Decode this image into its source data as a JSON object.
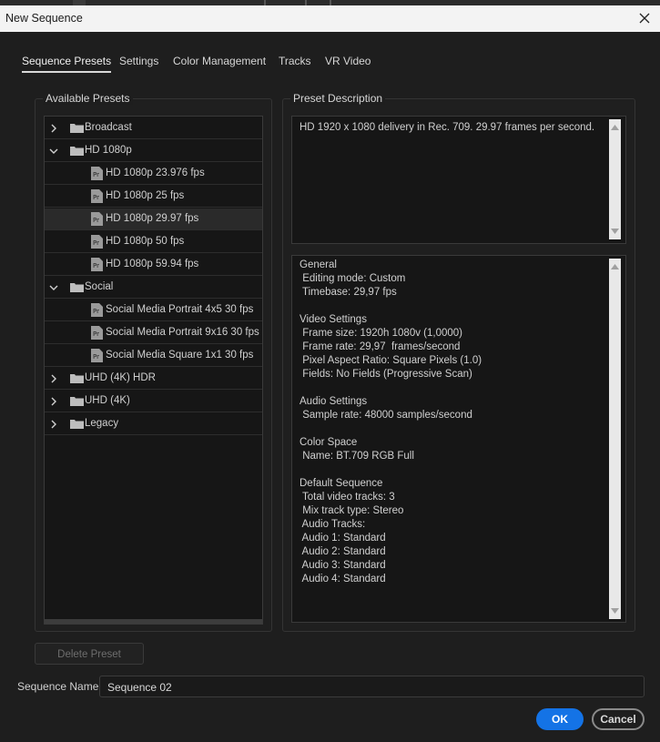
{
  "window": {
    "title": "New Sequence"
  },
  "tabs": [
    "Sequence Presets",
    "Settings",
    "Color Management",
    "Tracks",
    "VR Video"
  ],
  "active_tab": "Sequence Presets",
  "available_presets": {
    "label": "Available Presets",
    "tree": [
      {
        "label": "Broadcast",
        "type": "folder",
        "expanded": false
      },
      {
        "label": "HD 1080p",
        "type": "folder",
        "expanded": true
      },
      {
        "label": "HD 1080p 23.976 fps",
        "type": "preset"
      },
      {
        "label": "HD 1080p 25 fps",
        "type": "preset"
      },
      {
        "label": "HD 1080p 29.97 fps",
        "type": "preset",
        "selected": true
      },
      {
        "label": "HD 1080p 50 fps",
        "type": "preset"
      },
      {
        "label": "HD 1080p 59.94 fps",
        "type": "preset"
      },
      {
        "label": "Social",
        "type": "folder",
        "expanded": true
      },
      {
        "label": "Social Media Portrait 4x5 30 fps",
        "type": "preset"
      },
      {
        "label": "Social Media Portrait 9x16 30 fps",
        "type": "preset"
      },
      {
        "label": "Social Media Square 1x1 30 fps",
        "type": "preset"
      },
      {
        "label": "UHD (4K) HDR",
        "type": "folder",
        "expanded": false
      },
      {
        "label": "UHD (4K)",
        "type": "folder",
        "expanded": false
      },
      {
        "label": "Legacy",
        "type": "folder",
        "expanded": false
      }
    ]
  },
  "preset_description": {
    "label": "Preset Description",
    "text": "HD 1920 x 1080 delivery in Rec. 709. 29.97 frames per second.",
    "details": [
      "General",
      " Editing mode: Custom",
      " Timebase: 29,97 fps",
      "",
      "Video Settings",
      " Frame size: 1920h 1080v (1,0000)",
      " Frame rate: 29,97  frames/second",
      " Pixel Aspect Ratio: Square Pixels (1.0)",
      " Fields: No Fields (Progressive Scan)",
      "",
      "Audio Settings",
      " Sample rate: 48000 samples/second",
      "",
      "Color Space",
      " Name: BT.709 RGB Full",
      "",
      "Default Sequence",
      " Total video tracks: 3",
      " Mix track type: Stereo",
      " Audio Tracks:",
      " Audio 1: Standard",
      " Audio 2: Standard",
      " Audio 3: Standard",
      " Audio 4: Standard"
    ]
  },
  "delete_preset_label": "Delete Preset",
  "sequence_name": {
    "label": "Sequence Name:",
    "value": "Sequence 02"
  },
  "buttons": {
    "ok": "OK",
    "cancel": "Cancel"
  },
  "colors": {
    "accent": "#1473e6",
    "background": "#1e1e1e",
    "titlebar": "#f3f3f3"
  }
}
